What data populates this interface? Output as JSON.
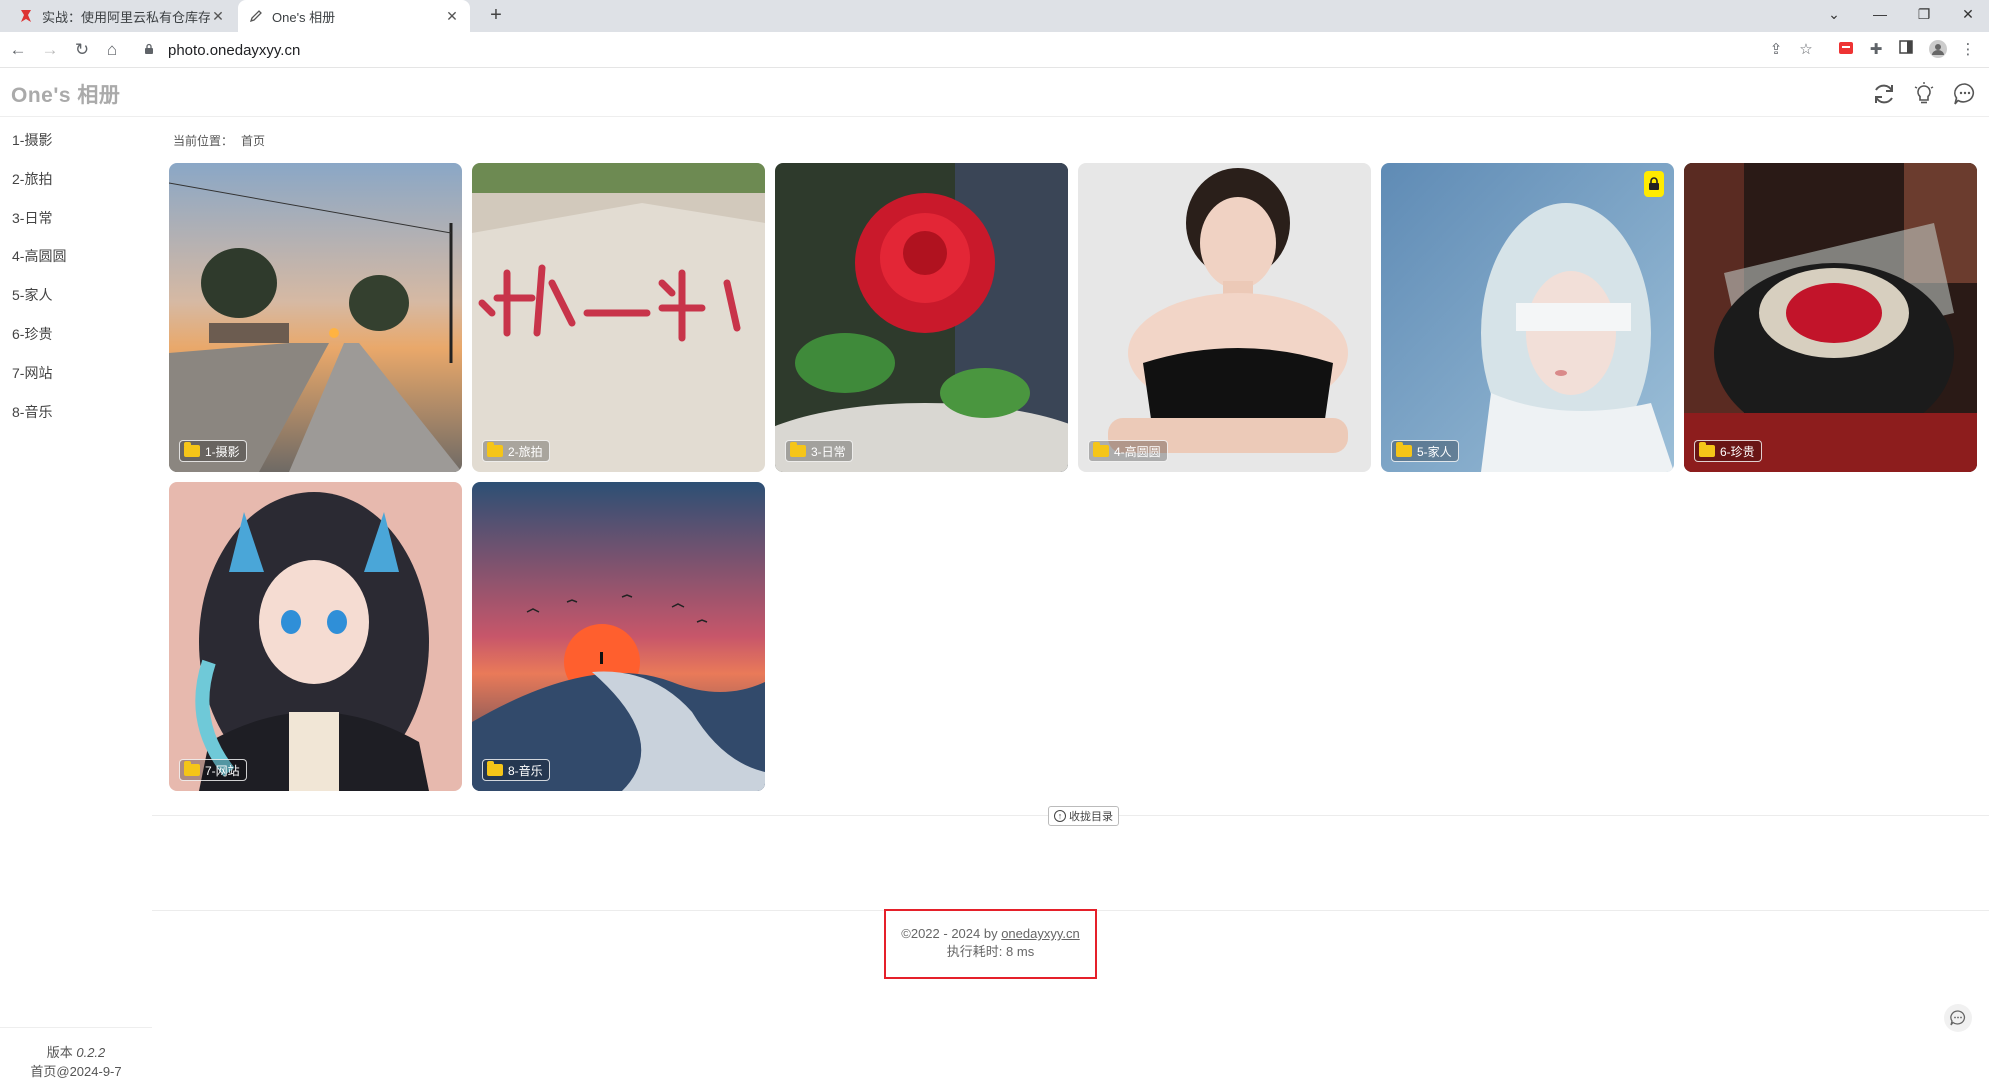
{
  "browser": {
    "tabs": [
      {
        "title": "实战：使用阿里云私有仓库存储镜像",
        "active": false,
        "favicon": "ribbon-icon"
      },
      {
        "title": "One's 相册",
        "active": true,
        "favicon": "pen-icon"
      }
    ],
    "url": "photo.onedayxyy.cn"
  },
  "site": {
    "logo": "One's 相册"
  },
  "sidebar": {
    "items": [
      "1-摄影",
      "2-旅拍",
      "3-日常",
      "4-高圆圆",
      "5-家人",
      "6-珍贵",
      "7-网站",
      "8-音乐"
    ],
    "version_label": "版本",
    "version": "0.2.2",
    "updated": "首页@2024-9-7"
  },
  "breadcrumb": {
    "label": "当前位置：",
    "current": "首页"
  },
  "albums": [
    {
      "name": "1-摄影",
      "locked": false
    },
    {
      "name": "2-旅拍",
      "locked": false
    },
    {
      "name": "3-日常",
      "locked": false
    },
    {
      "name": "4-高圆圆",
      "locked": false
    },
    {
      "name": "5-家人",
      "locked": true
    },
    {
      "name": "6-珍贵",
      "locked": false
    },
    {
      "name": "7-网站",
      "locked": false
    },
    {
      "name": "8-音乐",
      "locked": false
    }
  ],
  "collapse_label": "收拢目录",
  "footer": {
    "copyright": "©2022 - 2024 by ",
    "link": "onedayxyy.cn",
    "timing": "执行耗时: 8 ms"
  },
  "colors": {
    "accent_red": "#e5202a",
    "folder": "#f5c518",
    "lock_badge": "#ffeb00"
  }
}
